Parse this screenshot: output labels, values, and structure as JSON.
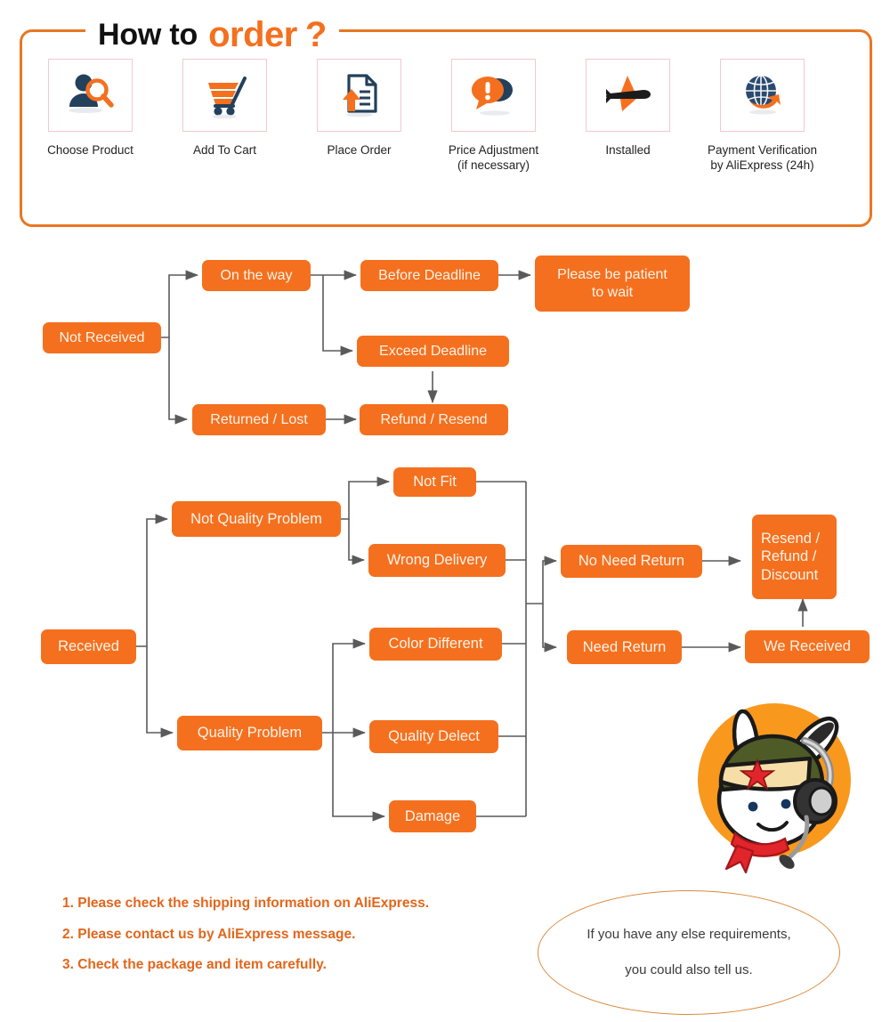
{
  "theme": {
    "orange": "#F4701F",
    "frame_border": "#E87722",
    "icon_box_border": "#F1C9CF",
    "note_text": "#E2661C",
    "wire": "#5a5a5a",
    "box_text": "#FFF3E8"
  },
  "header": {
    "title_black": "How to",
    "title_orange": "order",
    "title_q": "?",
    "steps": [
      {
        "icon": "person-search-icon",
        "label": "Choose Product"
      },
      {
        "icon": "shopping-cart-icon",
        "label": "Add To Cart"
      },
      {
        "icon": "document-upload-icon",
        "label": "Place Order"
      },
      {
        "icon": "chat-bubbles-alert-icon",
        "label": "Price Adjustment\n(if necessary)",
        "line1": "Price Adjustment",
        "line2": "(if necessary)"
      },
      {
        "icon": "airplane-icon",
        "label": "Installed"
      },
      {
        "icon": "globe-arrow-icon",
        "label": "Payment Verification\nby AliExpress (24h)",
        "line1": "Payment Verification",
        "line2": "by AliExpress (24h)"
      }
    ]
  },
  "flow_not_received": {
    "root": "Not Received",
    "on_the_way": "On the way",
    "before_deadline": "Before Deadline",
    "please_wait_l1": "Please be patient",
    "please_wait_l2": "to wait",
    "exceed_deadline": "Exceed Deadline",
    "returned_lost": "Returned / Lost",
    "refund_resend": "Refund / Resend"
  },
  "flow_received": {
    "root": "Received",
    "not_quality_problem": "Not Quality Problem",
    "quality_problem": "Quality Problem",
    "not_fit": "Not Fit",
    "wrong_delivery": "Wrong Delivery",
    "color_different": "Color Different",
    "quality_delect": "Quality Delect",
    "damage": "Damage",
    "no_need_return": "No Need Return",
    "need_return": "Need Return",
    "we_received": "We Received",
    "resend_l1": "Resend /",
    "resend_l2": "Refund /",
    "resend_l3": "Discount"
  },
  "notes": [
    "1. Please check the shipping information on AliExpress.",
    "2. Please contact us by AliExpress message.",
    "3. Check the package and item carefully."
  ],
  "callout": {
    "line1": "If you have any else requirements,",
    "line2": "you could also tell us."
  },
  "mascot": {
    "name": "mi-bunny-support-mascot"
  }
}
